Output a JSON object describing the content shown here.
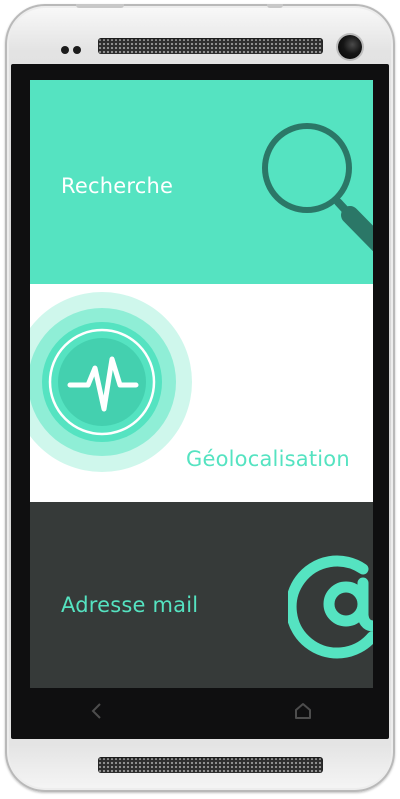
{
  "menu": {
    "items": [
      {
        "label": "Recherche",
        "icon": "magnifier-icon"
      },
      {
        "label": "Géolocalisation",
        "icon": "pulse-icon"
      },
      {
        "label": "Adresse mail",
        "icon": "at-sign-icon"
      }
    ]
  },
  "navbar": {
    "buttons": [
      "back-icon",
      "home-icon"
    ]
  },
  "colors": {
    "accent": "#55e3c1",
    "accent_dark": "#2e6b5e",
    "dark_panel": "#363a39",
    "white": "#ffffff",
    "bezel": "#0f0f10"
  }
}
